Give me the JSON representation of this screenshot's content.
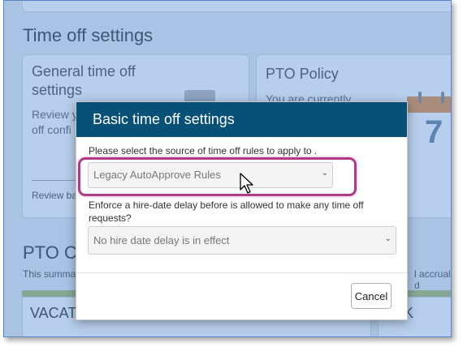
{
  "background": {
    "section_title": "Time off settings",
    "general_card": {
      "title_line1": "General time off",
      "title_line2": "settings",
      "text_line1": "Review y",
      "text_line2": "off confi",
      "link": "Review ba"
    },
    "pto_policy_card": {
      "title": "PTO Policy",
      "text": "You are currently"
    },
    "calendar_number": "7",
    "pto_section_title": "PTO Cl",
    "pto_section_sub": "This summa",
    "pto_section_sub_right": "l accrual d",
    "vacation_label": "VACAT",
    "right_letter": "K"
  },
  "modal": {
    "title": "Basic time off settings",
    "source_label": "Please select the source of time off rules to apply to .",
    "source_value": "Legacy AutoApprove Rules",
    "delay_label_line1": "Enforce a hire-date delay before is allowed to make any time off",
    "delay_label_line2": "requests?",
    "delay_value": "No hire date delay is in effect",
    "cancel_label": "Cancel"
  },
  "colors": {
    "modal_header": "#075077",
    "highlight": "#b13a87",
    "overlay": "#a9c3e4"
  }
}
